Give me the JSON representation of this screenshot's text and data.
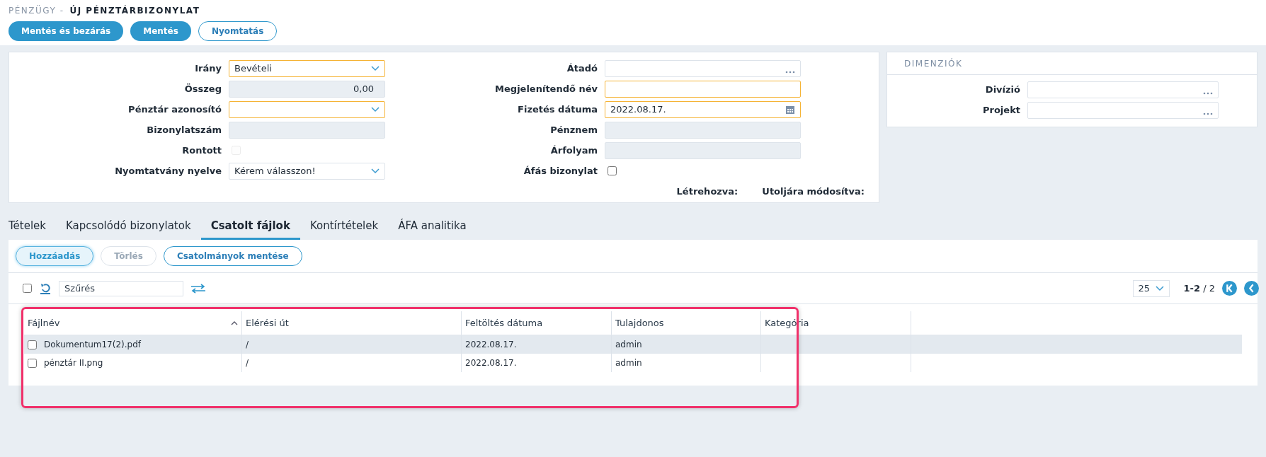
{
  "breadcrumb": {
    "section": "PÉNZÜGY -",
    "title": "ÚJ PÉNZTÁRBIZONYLAT"
  },
  "actions": [
    {
      "label": "Mentés és bezárás",
      "primary": true
    },
    {
      "label": "Mentés",
      "primary": true
    },
    {
      "label": "Nyomtatás",
      "primary": false
    }
  ],
  "form": {
    "left": [
      {
        "label": "Irány",
        "kind": "select",
        "value": "Bevételi",
        "required": true
      },
      {
        "label": "Összeg",
        "kind": "readonly",
        "value": "0,00",
        "required": false
      },
      {
        "label": "Pénztár azonosító",
        "kind": "select",
        "required": true
      },
      {
        "label": "Bizonylatszám",
        "kind": "readonly",
        "required": false
      },
      {
        "label": "Rontott",
        "kind": "checkbox",
        "checked": false,
        "disabled": true
      },
      {
        "label": "Nyomtatvány nyelve",
        "kind": "select",
        "value": "Kérem válasszon!",
        "required": false
      }
    ],
    "right": [
      {
        "label": "Átadó",
        "kind": "lookup",
        "required": false
      },
      {
        "label": "Megjelenítendő név",
        "kind": "text",
        "required": true
      },
      {
        "label": "Fizetés dátuma",
        "kind": "date",
        "value": "2022.08.17.",
        "required": true
      },
      {
        "label": "Pénznem",
        "kind": "readonly",
        "required": false
      },
      {
        "label": "Árfolyam",
        "kind": "readonly",
        "required": false
      },
      {
        "label": "Áfás bizonylat",
        "kind": "checkbox",
        "checked": false,
        "disabled": false
      }
    ],
    "meta": [
      "Létrehozva:",
      "Utoljára módosítva:"
    ]
  },
  "dimensions": {
    "title": "DIMENZIÓK",
    "fields": [
      {
        "label": "Divízió",
        "kind": "lookup",
        "required": false
      },
      {
        "label": "Projekt",
        "kind": "lookup",
        "required": false
      }
    ]
  },
  "tabs": [
    {
      "label": "Tételek",
      "selected": false
    },
    {
      "label": "Kapcsolódó bizonylatok",
      "selected": false
    },
    {
      "label": "Csatolt fájlok",
      "selected": true
    },
    {
      "label": "Kontírtételek",
      "selected": false
    },
    {
      "label": "ÁFA analitika",
      "selected": false
    }
  ],
  "panel_buttons": [
    {
      "label": "Hozzáadás",
      "focused": true,
      "disabled": false
    },
    {
      "label": "Törlés",
      "focused": false,
      "disabled": true
    },
    {
      "label": "Csatolmányok mentése",
      "focused": false,
      "disabled": false
    }
  ],
  "toolbar": {
    "select_all_checked": false,
    "filter_placeholder": "Szűrés",
    "page_size": "25",
    "range": "1-2",
    "total": "/ 2"
  },
  "table": {
    "columns": [
      "Fájlnév",
      "Elérési út",
      "Feltöltés dátuma",
      "Tulajdonos",
      "Kategória"
    ],
    "rows": [
      {
        "cells": [
          "Dokumentum17(2).pdf",
          "/",
          "2022.08.17.",
          "admin",
          ""
        ],
        "checked": false,
        "highlighted": true
      },
      {
        "cells": [
          "pénztár II.png",
          "/",
          "2022.08.17.",
          "admin",
          ""
        ],
        "checked": false,
        "highlighted": false
      }
    ]
  },
  "annotation": {
    "shown": true
  }
}
